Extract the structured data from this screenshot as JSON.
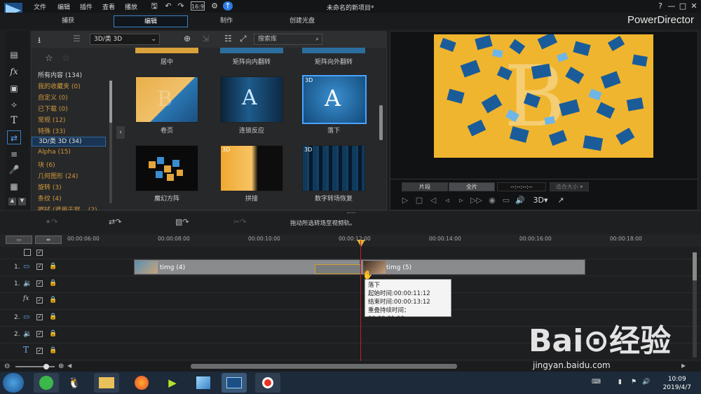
{
  "app": {
    "title": "未命名的新项目*",
    "brand": "PowerDirector"
  },
  "menu": [
    "文件",
    "编辑",
    "插件",
    "查看",
    "播放"
  ],
  "window_buttons": [
    "?",
    "—",
    "□",
    "✕"
  ],
  "modes": [
    "捕获",
    "编辑",
    "制作",
    "创建光盘"
  ],
  "library": {
    "filter_select": "3D/类 3D",
    "search_placeholder": "搜索库",
    "categories": [
      "所有内容 (134)",
      "我的收藏夹 (0)",
      "自定义 (0)",
      "已下载 (0)",
      "常规 (12)",
      "特殊 (33)",
      "3D/类 3D (34)",
      "Alpha (15)",
      "块 (6)",
      "几何图形 (24)",
      "旋转 (3)",
      "条纹 (4)",
      "擦拭 (遮用于窗... (2)"
    ],
    "top_labels": [
      "居中",
      "矩阵向内翻转",
      "矩阵向外翻转"
    ],
    "items": [
      {
        "label": "卷页",
        "badge": ""
      },
      {
        "label": "连锁反应",
        "badge": ""
      },
      {
        "label": "落下",
        "badge": "3D"
      },
      {
        "label": "魔幻方阵",
        "badge": ""
      },
      {
        "label": "拼接",
        "badge": "3D"
      },
      {
        "label": "数字转场恢复",
        "badge": "3D"
      }
    ]
  },
  "preview": {
    "clip_button": "片段",
    "full_button": "全片",
    "timecode": "--:--:--:--",
    "fit_label": "适合大小",
    "mode_3d": "3D"
  },
  "edit_hint": "拖动所选转场至视频轨。",
  "timeline": {
    "ticks": [
      "00:00:06:00",
      "00:00:08:00",
      "00:00:10:00",
      "00:00:12:00",
      "00:00:14:00",
      "00:00:16:00",
      "00:00:18:00"
    ],
    "tracks": [
      "1.",
      "1.",
      "fx",
      "2.",
      "2.",
      "T"
    ],
    "clips": [
      {
        "name": "timg (4)"
      },
      {
        "name": "timg (5)"
      }
    ],
    "tooltip": {
      "title": "落下",
      "start": "起始时间:00:00:11:12",
      "end": "结束时间:00:00:13:12",
      "overlap": "重叠持续时间： 00:00:01:00"
    }
  },
  "taskbar": {
    "time": "10:09",
    "date": "2019/4/7"
  },
  "watermark": {
    "main": "Bai⊙经验",
    "sub": "jingyan.baidu.com"
  }
}
